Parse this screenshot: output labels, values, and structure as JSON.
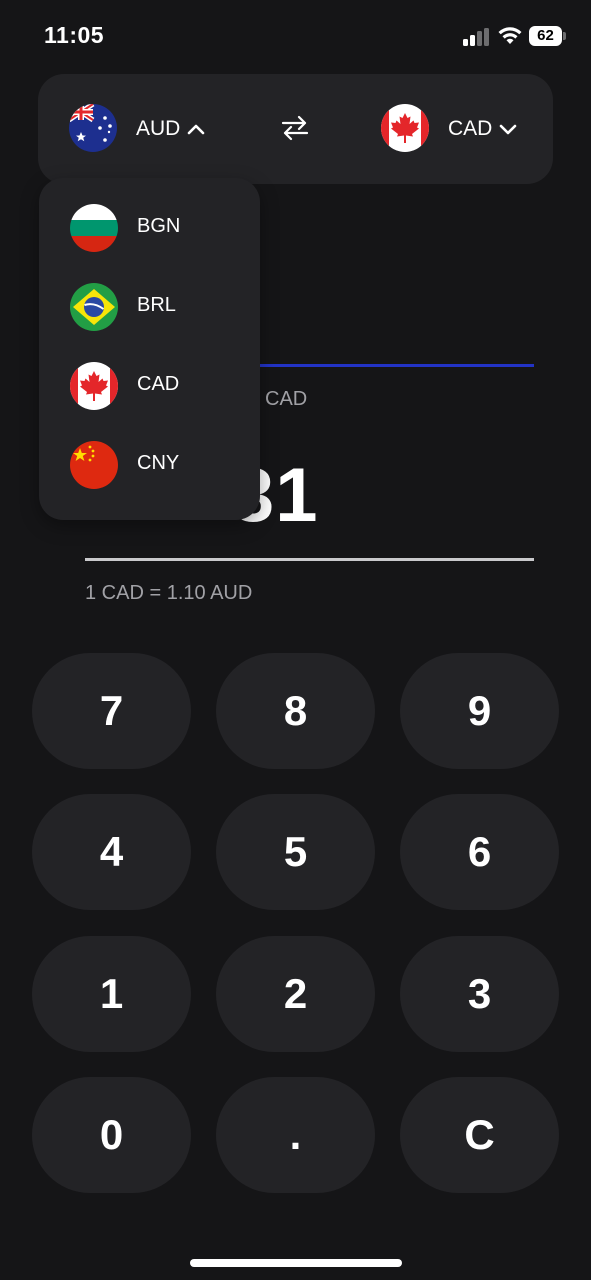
{
  "status_bar": {
    "time": "11:05",
    "battery": "62"
  },
  "selector": {
    "from_code": "AUD",
    "to_code": "CAD",
    "swap_icon": "swap-arrows-icon"
  },
  "conversion": {
    "to_currency_label": "CAD",
    "result_partial": "31",
    "rate_text": "1 CAD = 1.10 AUD"
  },
  "dropdown": {
    "items": [
      {
        "code": "BGN"
      },
      {
        "code": "BRL"
      },
      {
        "code": "CAD"
      },
      {
        "code": "CNY"
      }
    ]
  },
  "keypad": {
    "keys": [
      "7",
      "8",
      "9",
      "4",
      "5",
      "6",
      "1",
      "2",
      "3",
      "0",
      ".",
      "C"
    ]
  },
  "colors": {
    "background": "#151517",
    "card": "#232326",
    "accent_line": "#2233c6",
    "muted_text": "#a1a1a6"
  }
}
